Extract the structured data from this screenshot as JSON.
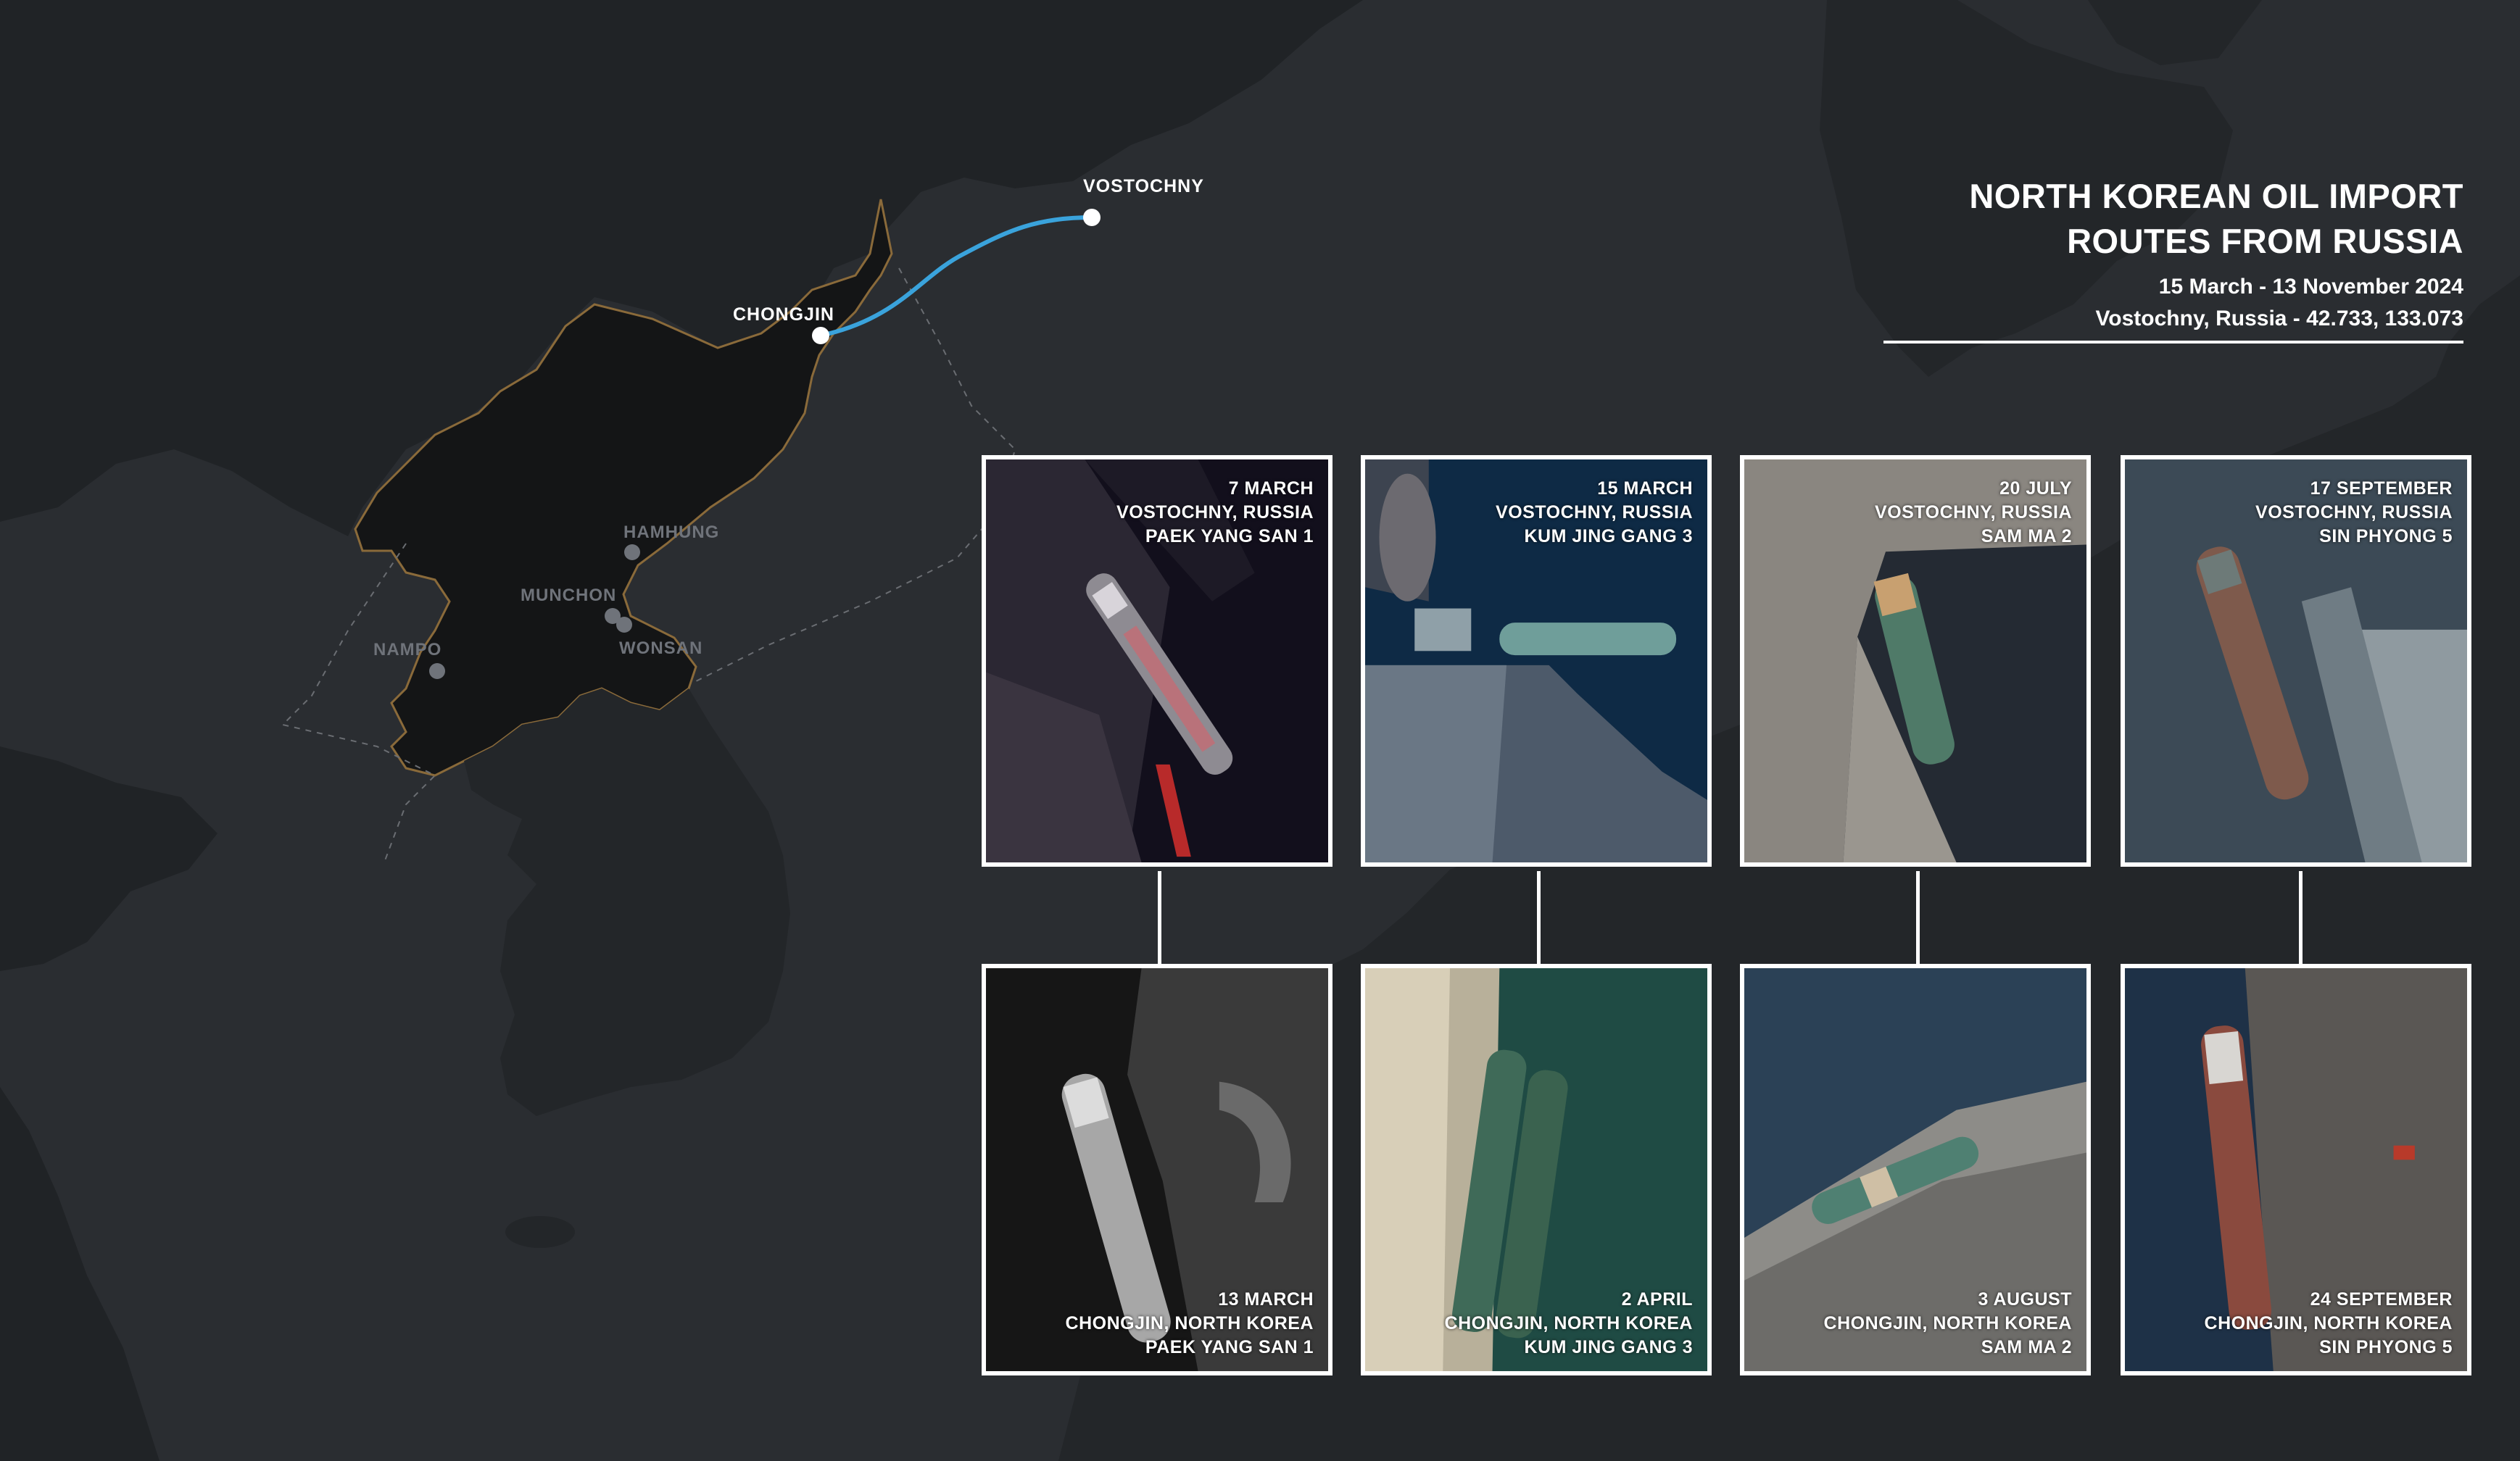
{
  "title": {
    "line1": "NORTH KOREAN OIL IMPORT",
    "line2": "ROUTES FROM RUSSIA",
    "dates": "15 March - 13 November 2024",
    "location": "Vostochny, Russia - 42.733, 133.073"
  },
  "map": {
    "route_color": "#3aa3dc",
    "land_color": "#232629",
    "nk_color": "#141516",
    "sea_color": "#2a2d31",
    "border_color": "#8a6a3a",
    "cities": {
      "vostochny": "VOSTOCHNY",
      "chongjin": "CHONGJIN",
      "hamhung": "HAMHUNG",
      "munchon": "MUNCHON",
      "wonsan": "WONSAN",
      "nampo": "NAMPO"
    }
  },
  "panels": {
    "top": [
      {
        "date": "7 MARCH",
        "place": "VOSTOCHNY, RUSSIA",
        "ship": "PAEK YANG SAN 1"
      },
      {
        "date": "15 MARCH",
        "place": "VOSTOCHNY, RUSSIA",
        "ship": "KUM JING GANG 3"
      },
      {
        "date": "20 JULY",
        "place": "VOSTOCHNY, RUSSIA",
        "ship": "SAM MA 2"
      },
      {
        "date": "17 SEPTEMBER",
        "place": "VOSTOCHNY, RUSSIA",
        "ship": "SIN PHYONG 5"
      }
    ],
    "bottom": [
      {
        "date": "13 MARCH",
        "place": "CHONGJIN, NORTH KOREA",
        "ship": "PAEK YANG SAN 1"
      },
      {
        "date": "2 APRIL",
        "place": "CHONGJIN, NORTH KOREA",
        "ship": "KUM JING GANG 3"
      },
      {
        "date": "3 AUGUST",
        "place": "CHONGJIN, NORTH KOREA",
        "ship": "SAM MA 2"
      },
      {
        "date": "24 SEPTEMBER",
        "place": "CHONGJIN, NORTH KOREA",
        "ship": "SIN PHYONG 5"
      }
    ]
  }
}
